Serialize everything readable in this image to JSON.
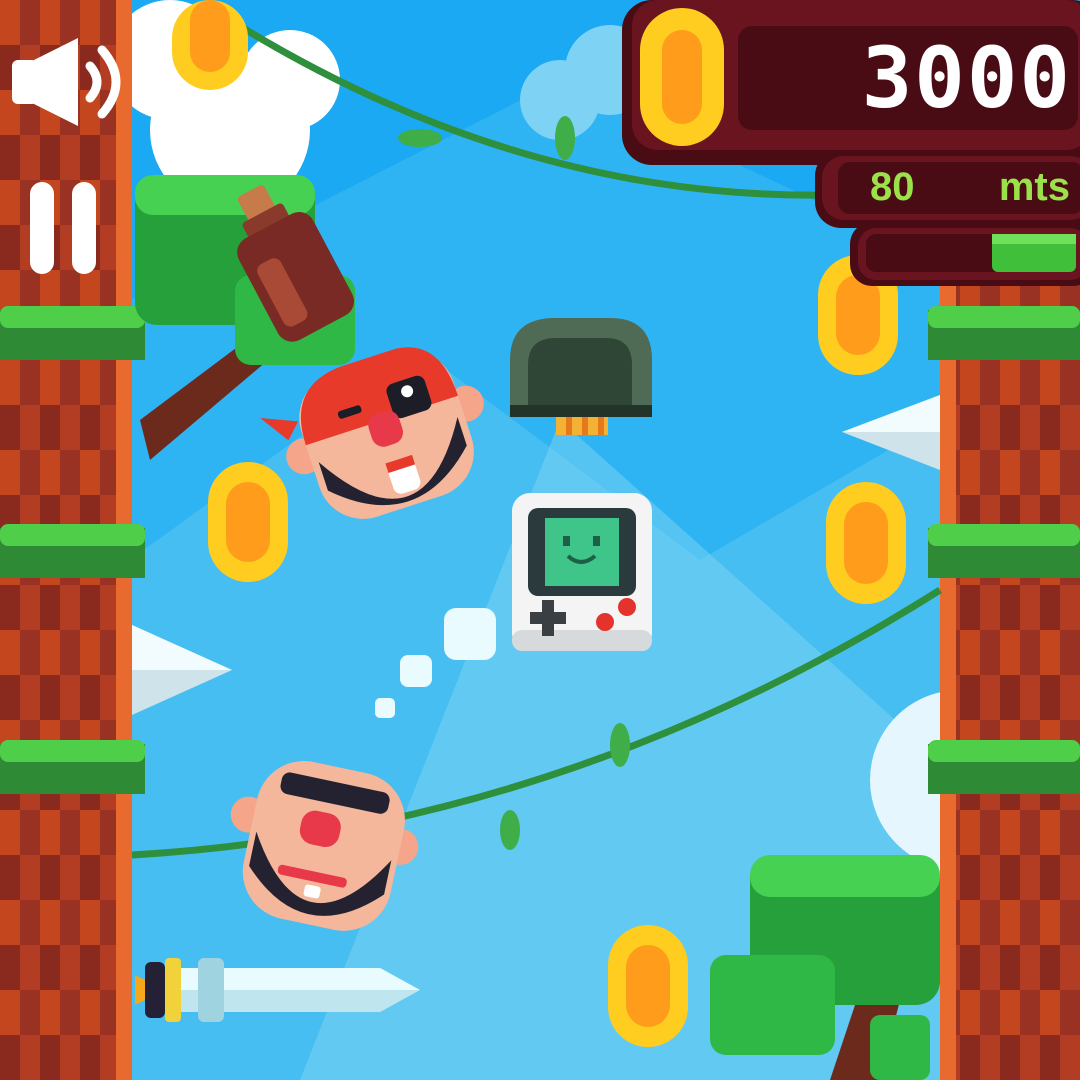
{
  "hud": {
    "score": "3000",
    "distance_value": "80",
    "distance_unit": "mts",
    "progress": 0.4
  },
  "controls": {
    "sound_icon": "speaker-icon",
    "pause_icon": "pause-icon"
  },
  "colors": {
    "sky": "#1aa9f2",
    "hud_panel": "#6a1420",
    "hud_text": "#ffffff",
    "distance_text": "#9be24a",
    "progress_fill": "#3fbf3a",
    "coin": "#ffcd1f"
  },
  "sprites": {
    "player": "handheld-console-character",
    "enemies": [
      "pirate-head-enemy",
      "sunglasses-head-enemy"
    ],
    "hazards": [
      "spike-icon",
      "sword-icon"
    ],
    "items": [
      "bottle-item",
      "coin-icon",
      "stone-cannon"
    ]
  }
}
